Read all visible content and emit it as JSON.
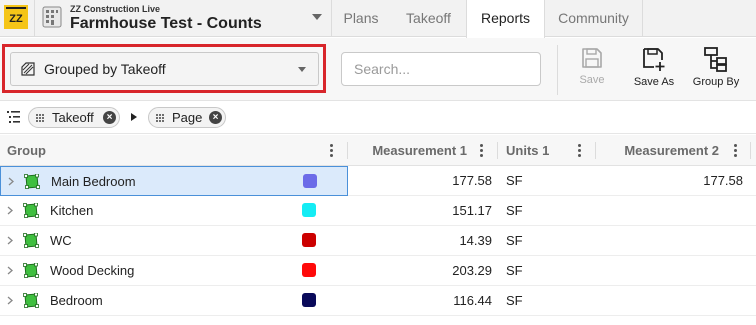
{
  "app": {
    "company": "ZZ Construction Live",
    "project": "Farmhouse Test - Counts"
  },
  "tabs": [
    {
      "label": "Plans",
      "active": false
    },
    {
      "label": "Takeoff",
      "active": false
    },
    {
      "label": "Reports",
      "active": true
    },
    {
      "label": "Community",
      "active": false
    }
  ],
  "toolbar": {
    "report_view": "Grouped by Takeoff",
    "search_placeholder": "Search...",
    "save_label": "Save",
    "save_as_label": "Save As",
    "group_by_label": "Group By"
  },
  "grouping": [
    "Takeoff",
    "Page"
  ],
  "columns": [
    "Group",
    "Measurement 1",
    "Units 1",
    "Measurement 2"
  ],
  "rows": [
    {
      "name": "Main Bedroom",
      "color": "#6b6be8",
      "measurement1": "177.58",
      "units1": "SF",
      "measurement2": "177.58",
      "selected": true
    },
    {
      "name": "Kitchen",
      "color": "#14ecf4",
      "measurement1": "151.17",
      "units1": "SF",
      "measurement2": "",
      "selected": false
    },
    {
      "name": "WC",
      "color": "#cc0000",
      "measurement1": "14.39",
      "units1": "SF",
      "measurement2": "",
      "selected": false
    },
    {
      "name": "Wood Decking",
      "color": "#ff0a0a",
      "measurement1": "203.29",
      "units1": "SF",
      "measurement2": "",
      "selected": false
    },
    {
      "name": "Bedroom",
      "color": "#0a0a5a",
      "measurement1": "116.44",
      "units1": "SF",
      "measurement2": "",
      "selected": false
    }
  ],
  "colors": {
    "accent_red": "#d8262b",
    "selection_blue": "#dbeafb",
    "area_icon_green": "#3fbf3f"
  }
}
